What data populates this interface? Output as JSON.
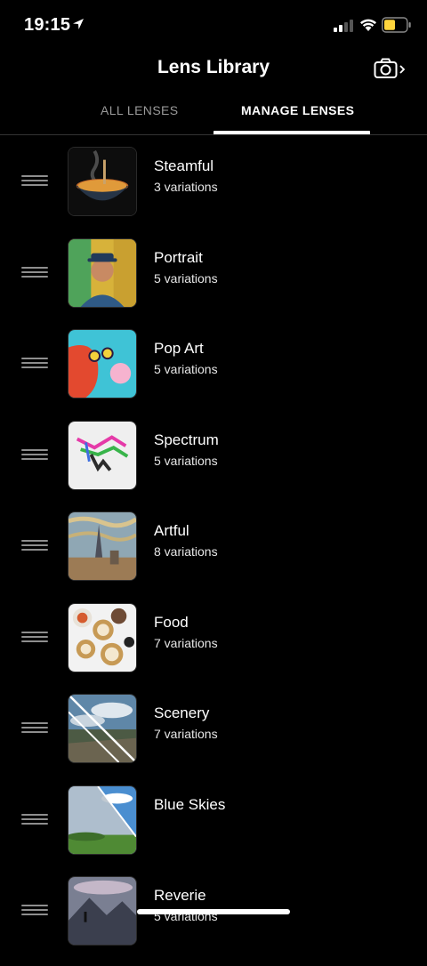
{
  "status": {
    "time": "19:15",
    "battery_color": "#ffd53d"
  },
  "header": {
    "title": "Lens Library",
    "camera_icon": "camera-icon"
  },
  "tabs": [
    {
      "label": "ALL LENSES",
      "active": false
    },
    {
      "label": "MANAGE LENSES",
      "active": true
    }
  ],
  "lenses": [
    {
      "name": "Steamful",
      "variations": "3 variations",
      "thumb": "noodle-bowl"
    },
    {
      "name": "Portrait",
      "variations": "5 variations",
      "thumb": "man-hat-portrait"
    },
    {
      "name": "Pop Art",
      "variations": "5 variations",
      "thumb": "pop-art-bubblegum"
    },
    {
      "name": "Spectrum",
      "variations": "5 variations",
      "thumb": "spectrum-dancers"
    },
    {
      "name": "Artful",
      "variations": "8 variations",
      "thumb": "city-painting"
    },
    {
      "name": "Food",
      "variations": "7 variations",
      "thumb": "dim-sum"
    },
    {
      "name": "Scenery",
      "variations": "7 variations",
      "thumb": "landscape-split"
    },
    {
      "name": "Blue Skies",
      "variations": "",
      "thumb": "blue-sky-field"
    },
    {
      "name": "Reverie",
      "variations": "5 variations",
      "thumb": "mountain-figure"
    }
  ]
}
